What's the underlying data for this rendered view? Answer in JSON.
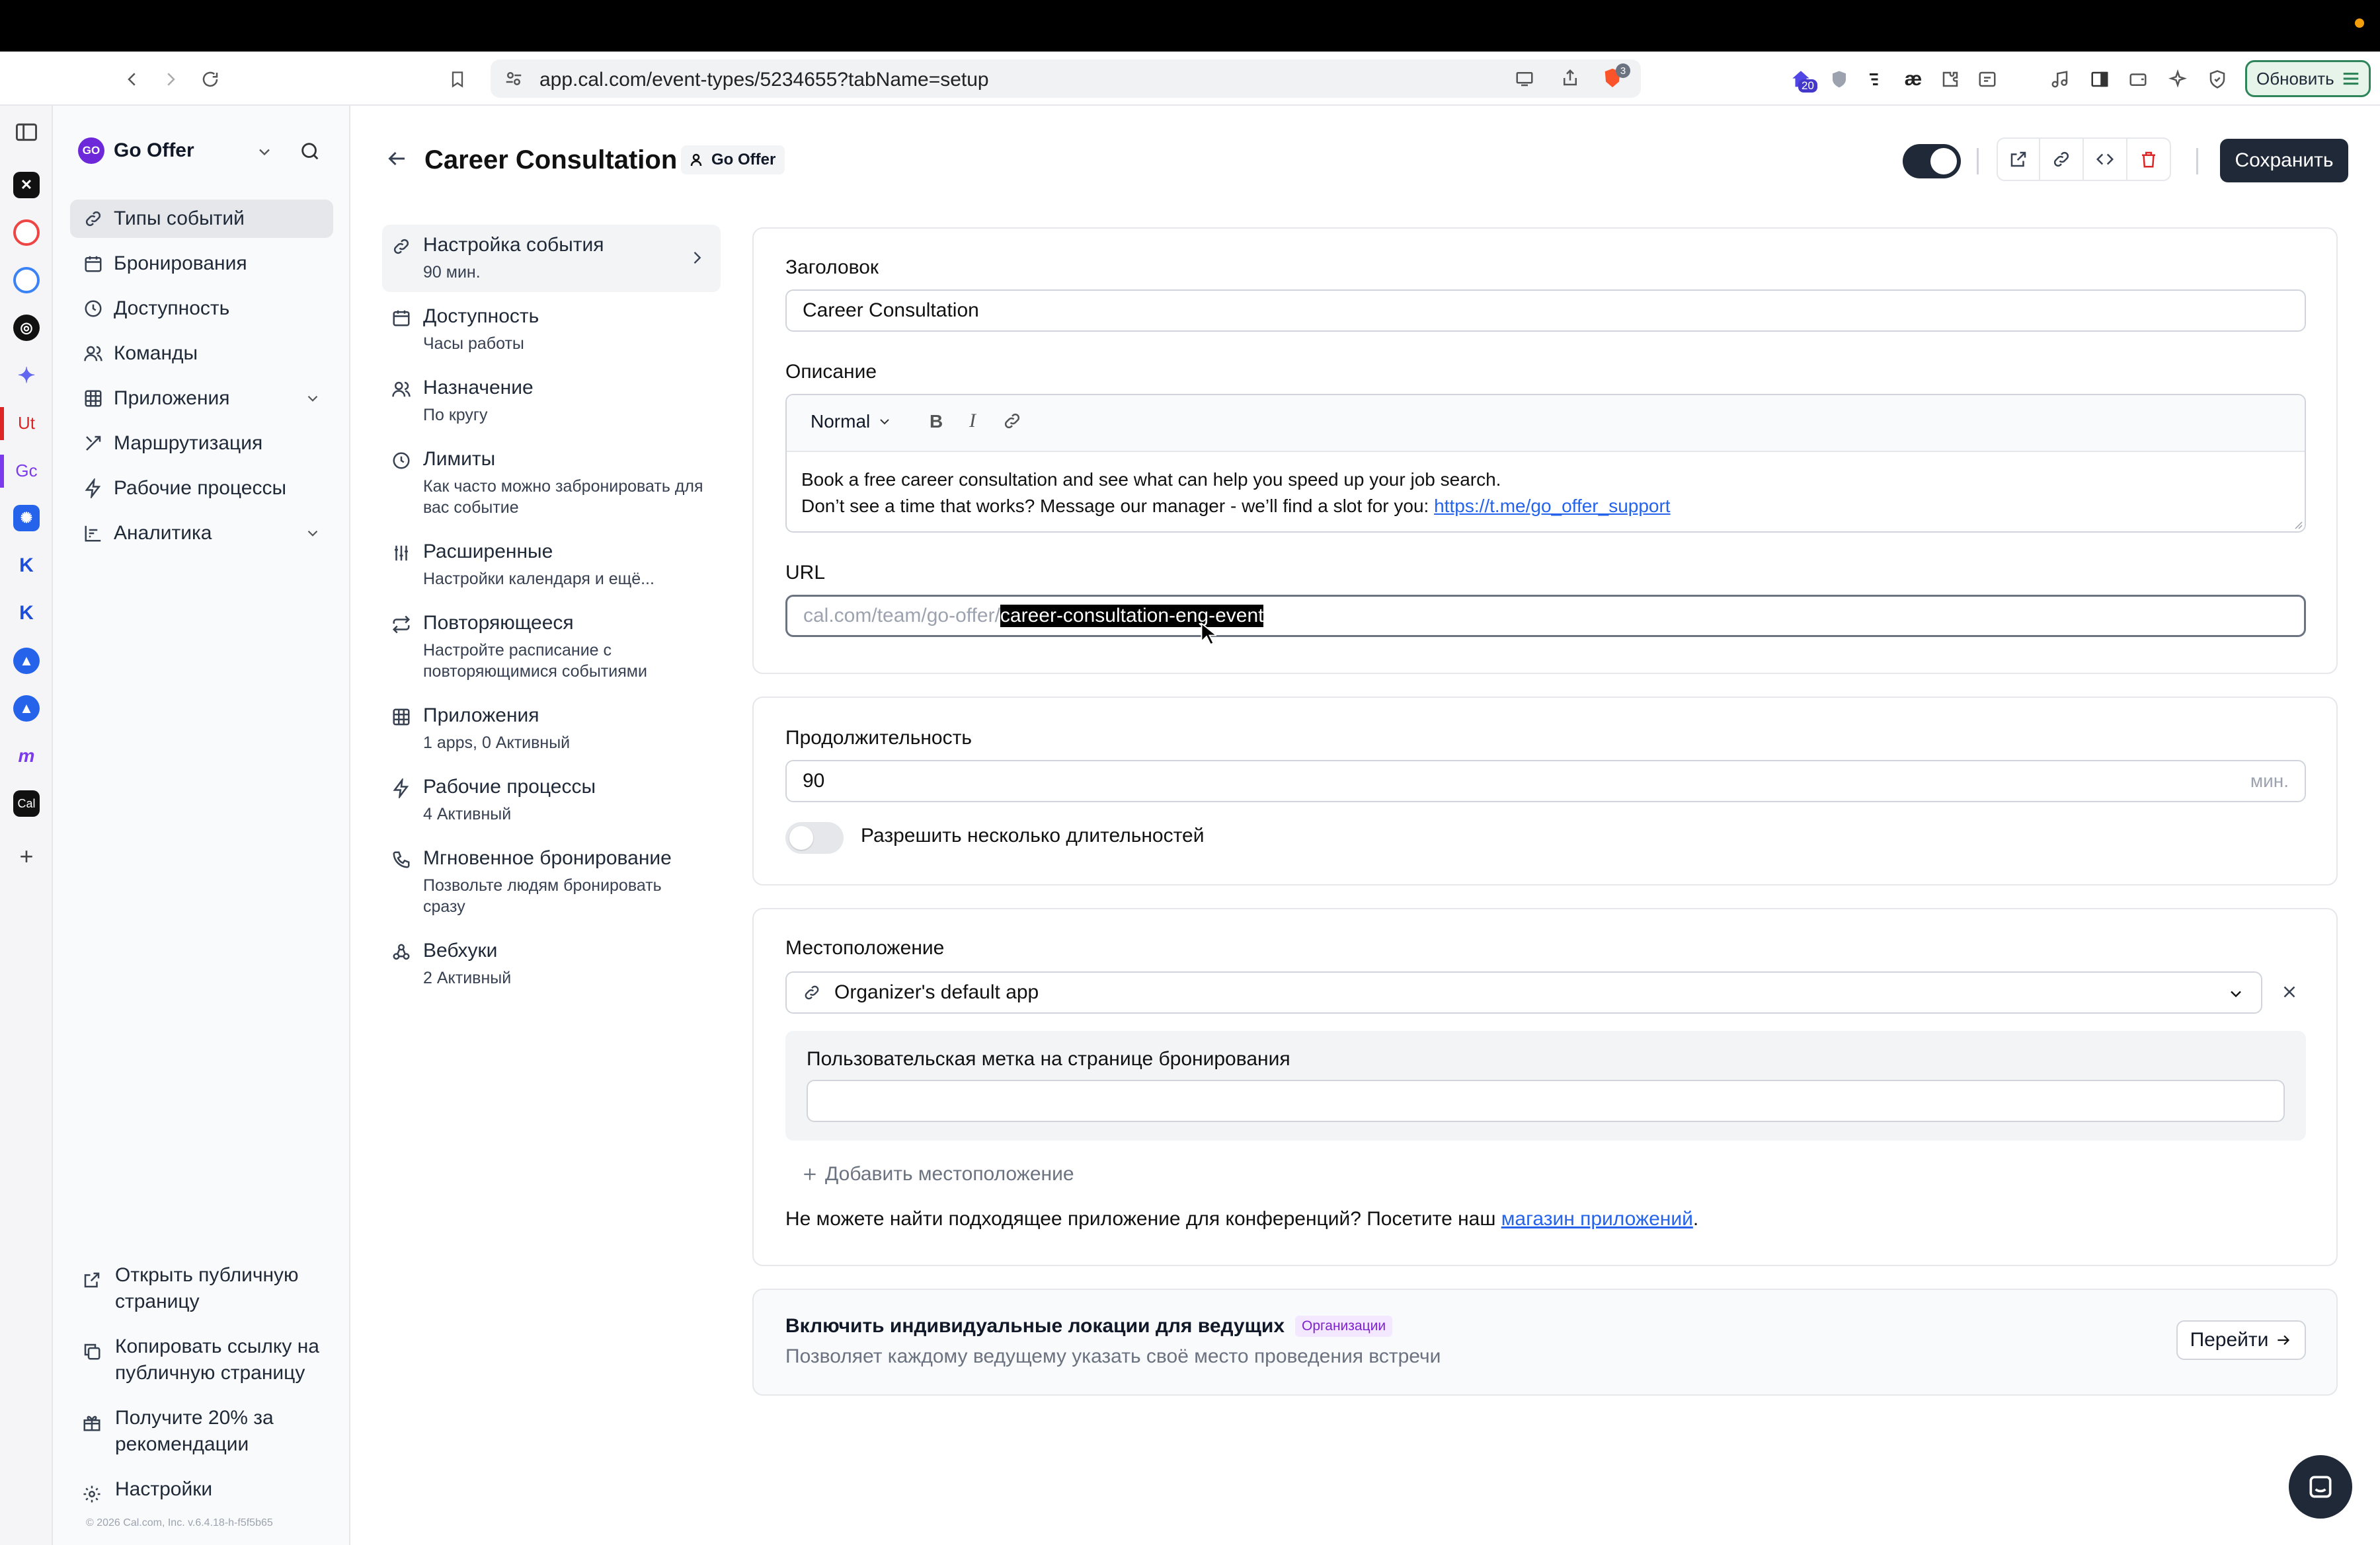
{
  "browser": {
    "url": "app.cal.com/event-types/5234655?tabName=setup",
    "update_label": "Обновить",
    "extension_badge": "20",
    "brave_badge": "3"
  },
  "rail": {
    "items": [
      "Ut",
      "Gc",
      "Cal"
    ]
  },
  "sidebar": {
    "org_name": "Go Offer",
    "org_avatar": "GO",
    "items": [
      {
        "label": "Типы событий",
        "icon": "link-icon"
      },
      {
        "label": "Бронирования",
        "icon": "calendar-icon"
      },
      {
        "label": "Доступность",
        "icon": "clock-icon"
      },
      {
        "label": "Команды",
        "icon": "users-icon"
      },
      {
        "label": "Приложения",
        "icon": "grid-icon"
      },
      {
        "label": "Маршрутизация",
        "icon": "routing-icon"
      },
      {
        "label": "Рабочие процессы",
        "icon": "zap-icon"
      },
      {
        "label": "Аналитика",
        "icon": "chart-icon"
      }
    ],
    "bottom": [
      {
        "label": "Открыть публичную страницу",
        "icon": "external-link-icon"
      },
      {
        "label": "Копировать ссылку на публичную страницу",
        "icon": "copy-icon"
      },
      {
        "label": "Получите 20% за рекомендации",
        "icon": "gift-icon"
      },
      {
        "label": "Настройки",
        "icon": "gear-icon"
      }
    ],
    "footer": "© 2026 Cal.com, Inc. v.6.4.18-h-f5f5b65"
  },
  "header": {
    "title": "Career Consultation",
    "team_badge": "Go Offer",
    "save_label": "Сохранить"
  },
  "nav": [
    {
      "title": "Настройка события",
      "subtitle": "90 мин."
    },
    {
      "title": "Доступность",
      "subtitle": "Часы работы"
    },
    {
      "title": "Назначение",
      "subtitle": "По кругу"
    },
    {
      "title": "Лимиты",
      "subtitle": "Как часто можно забронировать для вас событие"
    },
    {
      "title": "Расширенные",
      "subtitle": "Настройки календаря и ещё..."
    },
    {
      "title": "Повторяющееся",
      "subtitle": "Настройте расписание с повторяющимися событиями"
    },
    {
      "title": "Приложения",
      "subtitle": "1 apps, 0 Активный"
    },
    {
      "title": "Рабочие процессы",
      "subtitle": "4 Активный"
    },
    {
      "title": "Мгновенное бронирование",
      "subtitle": "Позвольте людям бронировать сразу"
    },
    {
      "title": "Вебхуки",
      "subtitle": "2 Активный"
    }
  ],
  "form": {
    "title_label": "Заголовок",
    "title_value": "Career Consultation",
    "description_label": "Описание",
    "format_select": "Normal",
    "description_line1": "Book a free career consultation and see what can help you speed up your job search.",
    "description_line2": "Don’t see a time that works? Message our manager - we’ll find a slot for you: ",
    "description_link": "https://t.me/go_offer_support",
    "url_label": "URL",
    "url_prefix": "cal.com/team/go-offer/",
    "url_slug": "career-consultation-eng-event",
    "duration_label": "Продолжительность",
    "duration_value": "90",
    "duration_unit": "мин.",
    "multiple_durations_label": "Разрешить несколько длительностей",
    "location_label": "Местоположение",
    "location_value": "Organizer's default app",
    "custom_label_title": "Пользовательская метка на странице бронирования",
    "custom_label_value": "",
    "add_location": "Добавить местоположение",
    "apps_text": "Не можете найти подходящее приложение для конференций? Посетите наш ",
    "apps_link": "магазин приложений",
    "apps_end": "."
  },
  "host_locations": {
    "title": "Включить индивидуальные локации для ведущих",
    "badge": "Организации",
    "description": "Позволяет каждому ведущему указать своё место проведения встречи",
    "button": "Перейти"
  },
  "colors": {
    "accent_link": "#2563eb",
    "dark_button": "#1f2937",
    "org_badge_bg": "#f3e8ff",
    "org_badge_text": "#7e22ce"
  }
}
